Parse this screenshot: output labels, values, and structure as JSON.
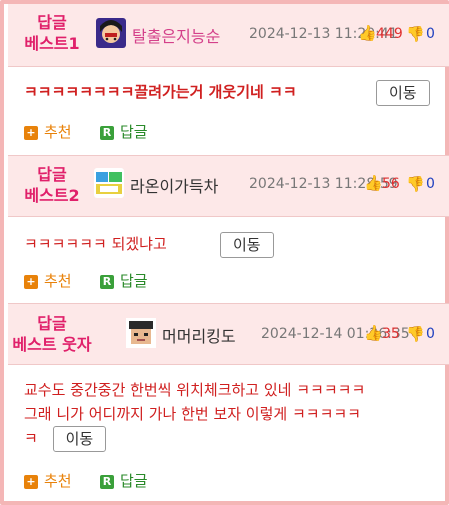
{
  "comments": [
    {
      "badge_line1": "답글",
      "badge_line2": "베스트1",
      "nickname": "탈출은지능순",
      "date": "2024-12-13 11:20:41",
      "upvotes": "449",
      "downvotes": "0",
      "text": "ㅋㅋㅋㅋㅋㅋㅋㅋ끌려가는거 개웃기네 ㅋㅋ",
      "move_label": "이동",
      "recommend_label": "추천",
      "reply_label": "답글"
    },
    {
      "badge_line1": "답글",
      "badge_line2": "베스트2",
      "nickname": "라온이가득차",
      "date": "2024-12-13 11:28:59",
      "upvotes": "56",
      "downvotes": "0",
      "text": "ㅋㅋㅋㅋㅋㅋ 되겠냐고",
      "move_label": "이동",
      "recommend_label": "추천",
      "reply_label": "답글"
    },
    {
      "badge_line1": "답글",
      "badge_line2": "베스트 웃자",
      "nickname": "머머리킹도",
      "date": "2024-12-14 01:26:35",
      "upvotes": "35",
      "downvotes": "0",
      "text_line1": "교수도 중간중간 한번씩 위치체크하고 있네 ㅋㅋㅋㅋㅋ",
      "text_line2": "그래 니가 어디까지 가나 한번 보자 이렇게 ㅋㅋㅋㅋㅋ",
      "text_line3": "ㅋ",
      "move_label": "이동",
      "recommend_label": "추천",
      "reply_label": "답글"
    }
  ],
  "icons": {
    "thumbs_up": "thumbs-up-icon",
    "thumbs_down": "thumbs-down-icon",
    "recommend": "plus-square-icon",
    "reply": "r-square-icon"
  },
  "colors": {
    "badge": "#e0206a",
    "header_bg": "#fde8e8",
    "frame": "#f4b6b6",
    "comment_text": "#d02020",
    "recommend": "#e8820a",
    "reply": "#3aa03a",
    "downvote": "#2040c0"
  }
}
